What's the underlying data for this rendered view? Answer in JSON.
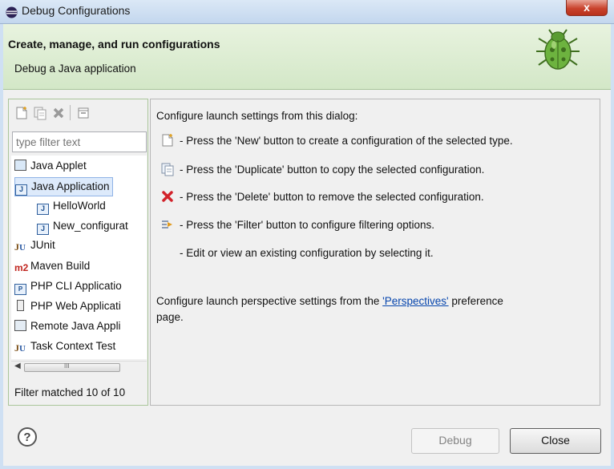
{
  "window": {
    "title": "Debug Configurations",
    "close_glyph": "x"
  },
  "banner": {
    "title": "Create, manage, and run configurations",
    "subtitle": "Debug a Java application"
  },
  "left": {
    "toolbar": [
      "new-config-icon",
      "duplicate-icon",
      "delete-icon",
      "filter-icon"
    ],
    "filter_placeholder": "type filter text",
    "tree": [
      {
        "label": "Java Applet"
      },
      {
        "label": "Java Application"
      },
      {
        "label": "HelloWorld"
      },
      {
        "label": "New_configurat"
      },
      {
        "label": "JUnit"
      },
      {
        "label": "Maven Build"
      },
      {
        "label": "PHP CLI Applicatio"
      },
      {
        "label": "PHP Web Applicati"
      },
      {
        "label": "Remote Java Appli"
      },
      {
        "label": "Task Context Test"
      }
    ],
    "scroll_glyph": "III",
    "status": "Filter matched 10 of 10"
  },
  "right": {
    "intro": "Configure launch settings from this dialog:",
    "lines": [
      "- Press the 'New' button to create a configuration of the selected type.",
      "- Press the 'Duplicate' button to copy the selected configuration.",
      "- Press the 'Delete' button to remove the selected configuration.",
      "- Press the 'Filter' button to configure filtering options.",
      "- Edit or view an existing configuration by selecting it."
    ],
    "persp_prefix": "Configure launch perspective settings from the",
    "persp_link": "'Perspectives'",
    "persp_suffix": "preference",
    "persp_line2": "page."
  },
  "buttons": {
    "help": "?",
    "debug": "Debug",
    "close": "Close"
  }
}
